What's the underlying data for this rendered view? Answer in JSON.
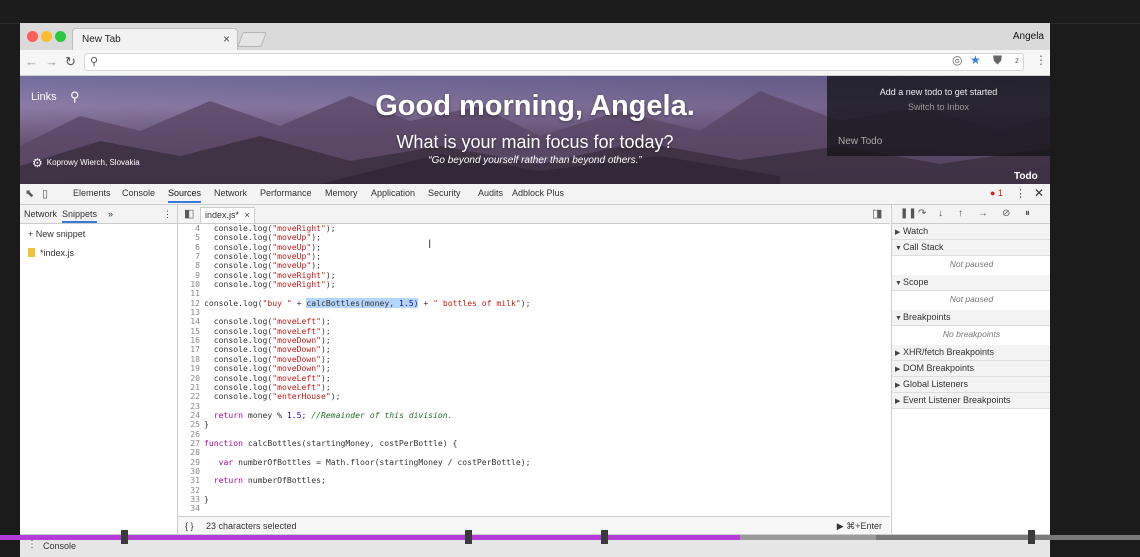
{
  "browser": {
    "tab_title": "New Tab",
    "tab_close": "×",
    "profile_name": "Angela",
    "address_value": ""
  },
  "hero": {
    "links_label": "Links",
    "greeting": "Good morning, Angela.",
    "focus_question": "What is your main focus for today?",
    "quote": "“Go beyond yourself rather than beyond others.”",
    "photo_location": "Koprowy Wierch, Slovakia",
    "todo_add": "Add a new todo to get started",
    "todo_switch": "Switch to Inbox",
    "todo_placeholder": "New Todo",
    "todo_label": "Todo"
  },
  "devtools": {
    "tabs": [
      "Elements",
      "Console",
      "Sources",
      "Network",
      "Performance",
      "Memory",
      "Application",
      "Security",
      "Audits",
      "Adblock Plus"
    ],
    "active_tab": "Sources",
    "error_count": "1",
    "navigator_tabs": [
      "Network",
      "Snippets"
    ],
    "navigator_more": "»",
    "new_snippet_label": "+ New snippet",
    "snippet_file": "*index.js",
    "editor_tab": "index.js*",
    "status_braces": "{ }",
    "status_selection": "23 characters selected",
    "run_hint": "▶ ⌘+Enter",
    "drawer_tab": "Console",
    "debugger_sections": [
      {
        "name": "Watch",
        "open": false,
        "body": ""
      },
      {
        "name": "Call Stack",
        "open": true,
        "body": "Not paused"
      },
      {
        "name": "Scope",
        "open": true,
        "body": "Not paused"
      },
      {
        "name": "Breakpoints",
        "open": true,
        "body": "No breakpoints"
      },
      {
        "name": "XHR/fetch Breakpoints",
        "open": false,
        "body": ""
      },
      {
        "name": "DOM Breakpoints",
        "open": false,
        "body": ""
      },
      {
        "name": "Global Listeners",
        "open": false,
        "body": ""
      },
      {
        "name": "Event Listener Breakpoints",
        "open": false,
        "body": ""
      }
    ]
  },
  "code_lines": [
    {
      "n": "4",
      "t": "  console.log(\"moveRight\");"
    },
    {
      "n": "5",
      "t": "  console.log(\"moveUp\");"
    },
    {
      "n": "6",
      "t": "  console.log(\"moveUp\");"
    },
    {
      "n": "7",
      "t": "  console.log(\"moveUp\");"
    },
    {
      "n": "8",
      "t": "  console.log(\"moveUp\");"
    },
    {
      "n": "9",
      "t": "  console.log(\"moveRight\");"
    },
    {
      "n": "10",
      "t": "  console.log(\"moveRight\");"
    },
    {
      "n": "11",
      "t": ""
    },
    {
      "n": "12",
      "t": "console.log(\"buy \" + calcBottles(money, 1.5) + \" bottles of milk\");"
    },
    {
      "n": "13",
      "t": ""
    },
    {
      "n": "14",
      "t": "  console.log(\"moveLeft\");"
    },
    {
      "n": "15",
      "t": "  console.log(\"moveLeft\");"
    },
    {
      "n": "16",
      "t": "  console.log(\"moveDown\");"
    },
    {
      "n": "17",
      "t": "  console.log(\"moveDown\");"
    },
    {
      "n": "18",
      "t": "  console.log(\"moveDown\");"
    },
    {
      "n": "19",
      "t": "  console.log(\"moveDown\");"
    },
    {
      "n": "20",
      "t": "  console.log(\"moveLeft\");"
    },
    {
      "n": "21",
      "t": "  console.log(\"moveLeft\");"
    },
    {
      "n": "22",
      "t": "  console.log(\"enterHouse\");"
    },
    {
      "n": "23",
      "t": ""
    },
    {
      "n": "24",
      "t": "  return money % 1.5; //Remainder of this division."
    },
    {
      "n": "25",
      "t": "}"
    },
    {
      "n": "26",
      "t": ""
    },
    {
      "n": "27",
      "t": "function calcBottles(startingMoney, costPerBottle) {"
    },
    {
      "n": "28",
      "t": ""
    },
    {
      "n": "29",
      "t": "   var numberOfBottles = Math.floor(startingMoney / costPerBottle);"
    },
    {
      "n": "30",
      "t": ""
    },
    {
      "n": "31",
      "t": "  return numberOfBottles;"
    },
    {
      "n": "32",
      "t": ""
    },
    {
      "n": "33",
      "t": "}"
    },
    {
      "n": "34",
      "t": ""
    }
  ],
  "selection_text": "calcBottles(money, 1.5)",
  "video": {
    "played_fraction": 0.65
  }
}
